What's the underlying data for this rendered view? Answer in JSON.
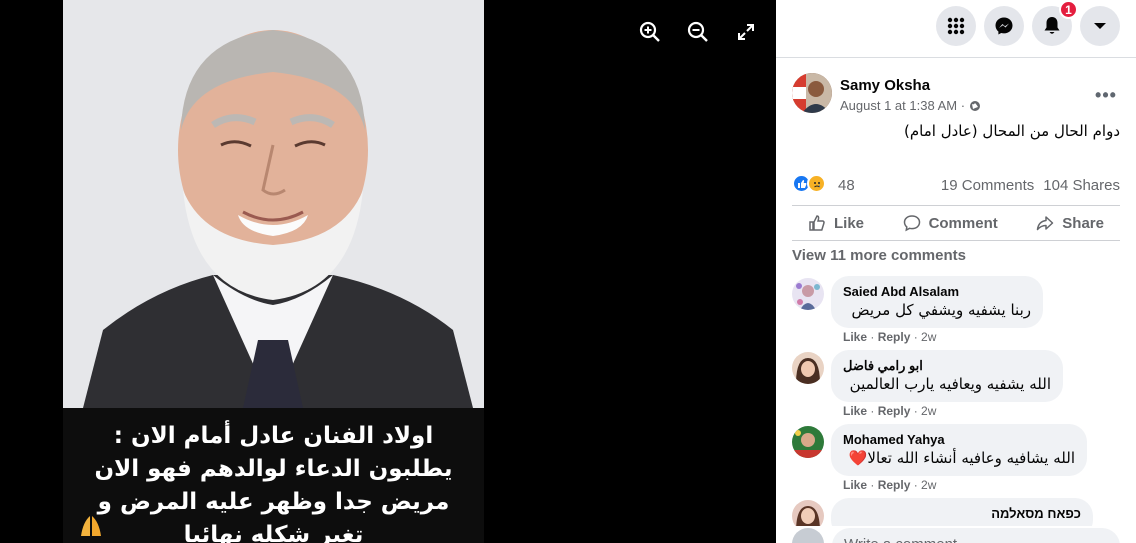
{
  "viewer": {
    "caption": "اولاد الفنان عادل أمام الان : يطلبون الدعاء لوالدهم فهو الان مريض جدا وظهر عليه المرض و تغير شكله نهائيا",
    "icons": [
      "zoom-in-icon",
      "zoom-out-icon",
      "fullscreen-icon"
    ]
  },
  "topbar": {
    "icons": [
      "menu-grid-icon",
      "messenger-icon",
      "notifications-icon",
      "account-dropdown-icon"
    ],
    "notification_count": "1"
  },
  "post": {
    "author": "Samy Oksha",
    "timestamp": "August 1 at 1:38 AM · ",
    "privacy_icon": "globe-icon",
    "text": "دوام الحال من المحال (عادل امام)",
    "reaction_count": "48",
    "comments_count": "19 Comments",
    "shares_count": "104 Shares",
    "actions": {
      "like": "Like",
      "comment": "Comment",
      "share": "Share"
    }
  },
  "comments_section": {
    "view_more": "View 11 more comments",
    "comments": [
      {
        "name": "Saied Abd Alsalam",
        "text": "ربنا يشفيه ويشفي كل مريض",
        "like": "Like",
        "reply": "Reply",
        "time": "2w"
      },
      {
        "name": "ابو رامي فاضل",
        "text": "الله يشفيه ويعافيه يارب العالمين",
        "like": "Like",
        "reply": "Reply",
        "time": "2w"
      },
      {
        "name": "Mohamed Yahya",
        "text": "الله يشافيه وعافيه أنشاء الله تعالا❤️",
        "like": "Like",
        "reply": "Reply",
        "time": "2w"
      },
      {
        "name": "כפאח מסאלמה",
        "text": "",
        "like": "",
        "reply": "",
        "time": ""
      }
    ],
    "input_placeholder": "Write a comment..."
  },
  "colors": {
    "like_blue": "#1877f2",
    "sad_yellow": "#f7b125",
    "badge_red": "#e41e3f",
    "panel_bg": "#ffffff",
    "bubble_bg": "#f0f2f5"
  }
}
